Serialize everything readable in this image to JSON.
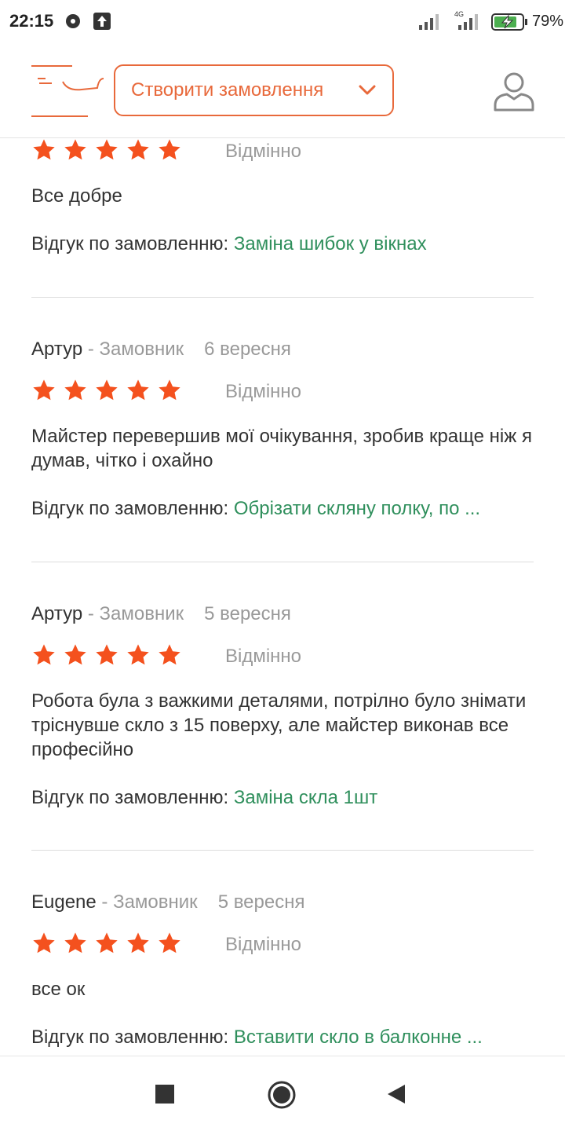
{
  "status_bar": {
    "time": "22:15",
    "battery_percent": "79%",
    "network": "4G",
    "icons": [
      "media-icon",
      "upload-icon",
      "signal-icon",
      "signal-4g-icon",
      "battery-charging-icon"
    ]
  },
  "header": {
    "create_order_label": "Створити замовлення",
    "icons": [
      "logo",
      "chevron-down-icon",
      "profile-icon"
    ]
  },
  "colors": {
    "accent": "#e8693b",
    "star": "#f4511e",
    "link": "#2f8f5c",
    "muted": "#999999"
  },
  "reviews": [
    {
      "author": "",
      "role": "",
      "date": "",
      "rating": 5,
      "rating_label": "Відмінно",
      "text": "Все добре",
      "order_prefix": "Відгук по замовленню:",
      "order_title": "Заміна шибок у вікнах"
    },
    {
      "author": "Артур",
      "role": " - Замовник",
      "date": "6 вересня",
      "rating": 5,
      "rating_label": "Відмінно",
      "text": "Майстер перевершив мої очікування, зробив краще ніж я думав, чітко і охайно",
      "order_prefix": "Відгук по замовленню:",
      "order_title": "Обрізати скляну полку, по ..."
    },
    {
      "author": "Артур",
      "role": " - Замовник",
      "date": "5 вересня",
      "rating": 5,
      "rating_label": "Відмінно",
      "text": "Робота була з важкими деталями, потрілно було знімати тріснувше скло з 15 поверху, але майстер виконав все професійно",
      "order_prefix": "Відгук по замовленню:",
      "order_title": "Заміна скла 1шт"
    },
    {
      "author": "Eugene",
      "role": " - Замовник",
      "date": "5 вересня",
      "rating": 5,
      "rating_label": "Відмінно",
      "text": "все ок",
      "order_prefix": "Відгук по замовленню:",
      "order_title": "Вставити скло в балконне ..."
    }
  ],
  "nav_bar": {
    "icons": [
      "recents-icon",
      "home-icon",
      "back-icon"
    ]
  }
}
